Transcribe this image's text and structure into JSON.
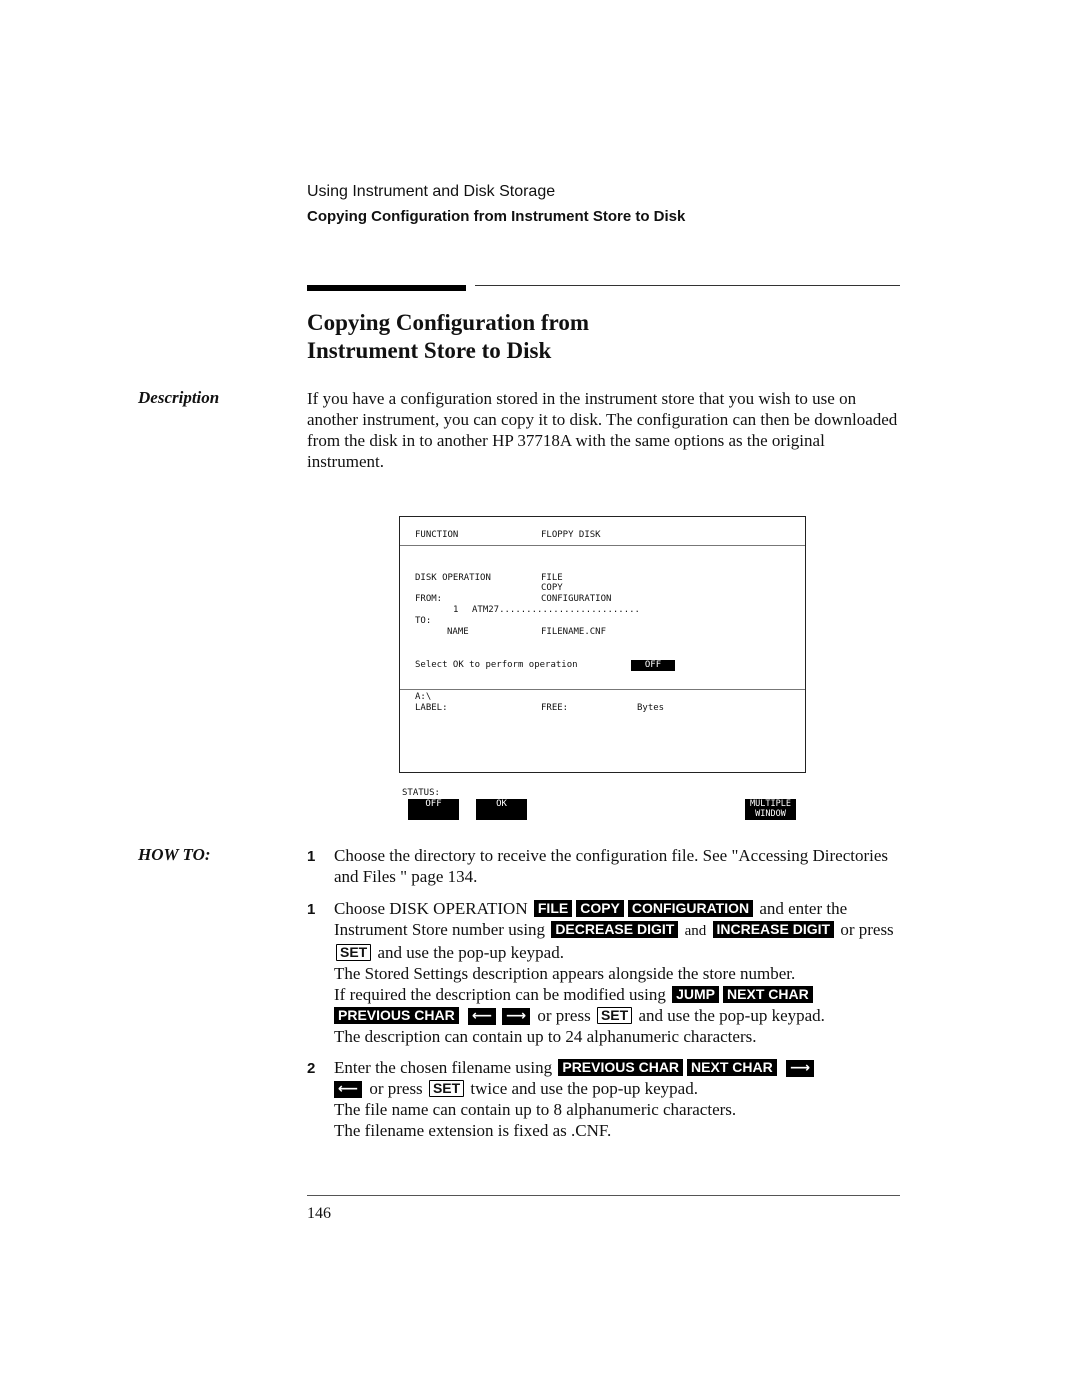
{
  "header": {
    "chapter": "Using Instrument and Disk Storage",
    "section": "Copying Configuration from Instrument Store to Disk"
  },
  "title": {
    "line1": "Copying Configuration from",
    "line2": "Instrument Store to Disk"
  },
  "description": {
    "label": "Description",
    "text": "If you have a configuration stored in the instrument store that you wish to use on another instrument, you can copy it to disk. The configuration can then be downloaded from the disk in to another HP 37718A with the same options as the original instrument."
  },
  "screen": {
    "function_label": "FUNCTION",
    "function_value": "FLOPPY DISK",
    "disk_operation_label": "DISK OPERATION",
    "disk_operation_values": [
      "FILE",
      "COPY",
      "CONFIGURATION"
    ],
    "from_label": "FROM:",
    "from_store_number": "1",
    "from_store_name": "ATM27..........................",
    "to_label": "TO:",
    "name_label": "NAME",
    "name_value": "FILENAME.CNF",
    "prompt": "Select OK to perform operation",
    "prompt_value": "OFF",
    "drive": "A:\\",
    "label_label": "LABEL:",
    "free_label": "FREE:",
    "bytes_label": "Bytes",
    "status_label": "STATUS:",
    "softkeys": [
      "OFF",
      "OK"
    ],
    "multiple_window": [
      "MULTIPLE",
      "WINDOW"
    ]
  },
  "howto": {
    "label": "HOW TO:",
    "steps": [
      {
        "number": "1",
        "text_a": "Choose the directory to receive the configuration file. See  \"Accessing Directories and Files \"  page 134."
      },
      {
        "number": "1",
        "text_a": "Choose DISK OPERATION",
        "key_file": "FILE",
        "key_copy": "COPY",
        "key_configuration": "CONFIGURATION",
        "text_b": "and enter the Instrument Store number using",
        "key_decrease": "DECREASE DIGIT",
        "text_c": "and",
        "key_increase": "INCREASE DIGIT",
        "text_d": "or press",
        "hard_set": "SET",
        "text_e": "and use the pop-up keypad.",
        "text_f": "The Stored Settings description appears alongside the store number.",
        "text_g": "If required the description can be modified using",
        "key_jump": "JUMP",
        "key_next_char": "NEXT CHAR",
        "key_previous_char": "PREVIOUS CHAR",
        "arrow_left": "⟵",
        "arrow_right": "⟶",
        "text_h": "or press",
        "hard_set2": "SET",
        "text_i": "and use the pop-up keypad.",
        "text_j": "The description can contain up to 24 alphanumeric characters."
      },
      {
        "number": "2",
        "text_a": "Enter the chosen filename using",
        "key_previous_char": "PREVIOUS CHAR",
        "key_next_char": "NEXT CHAR",
        "arrow_right": "⟶",
        "arrow_left": "⟵",
        "text_b": "or press",
        "hard_set": "SET",
        "text_c": "twice and use the pop-up keypad.",
        "text_d": "The file name can contain up to 8 alphanumeric characters.",
        "text_e": "The filename extension is fixed as .CNF."
      }
    ]
  },
  "footer": {
    "page_number": "146"
  }
}
